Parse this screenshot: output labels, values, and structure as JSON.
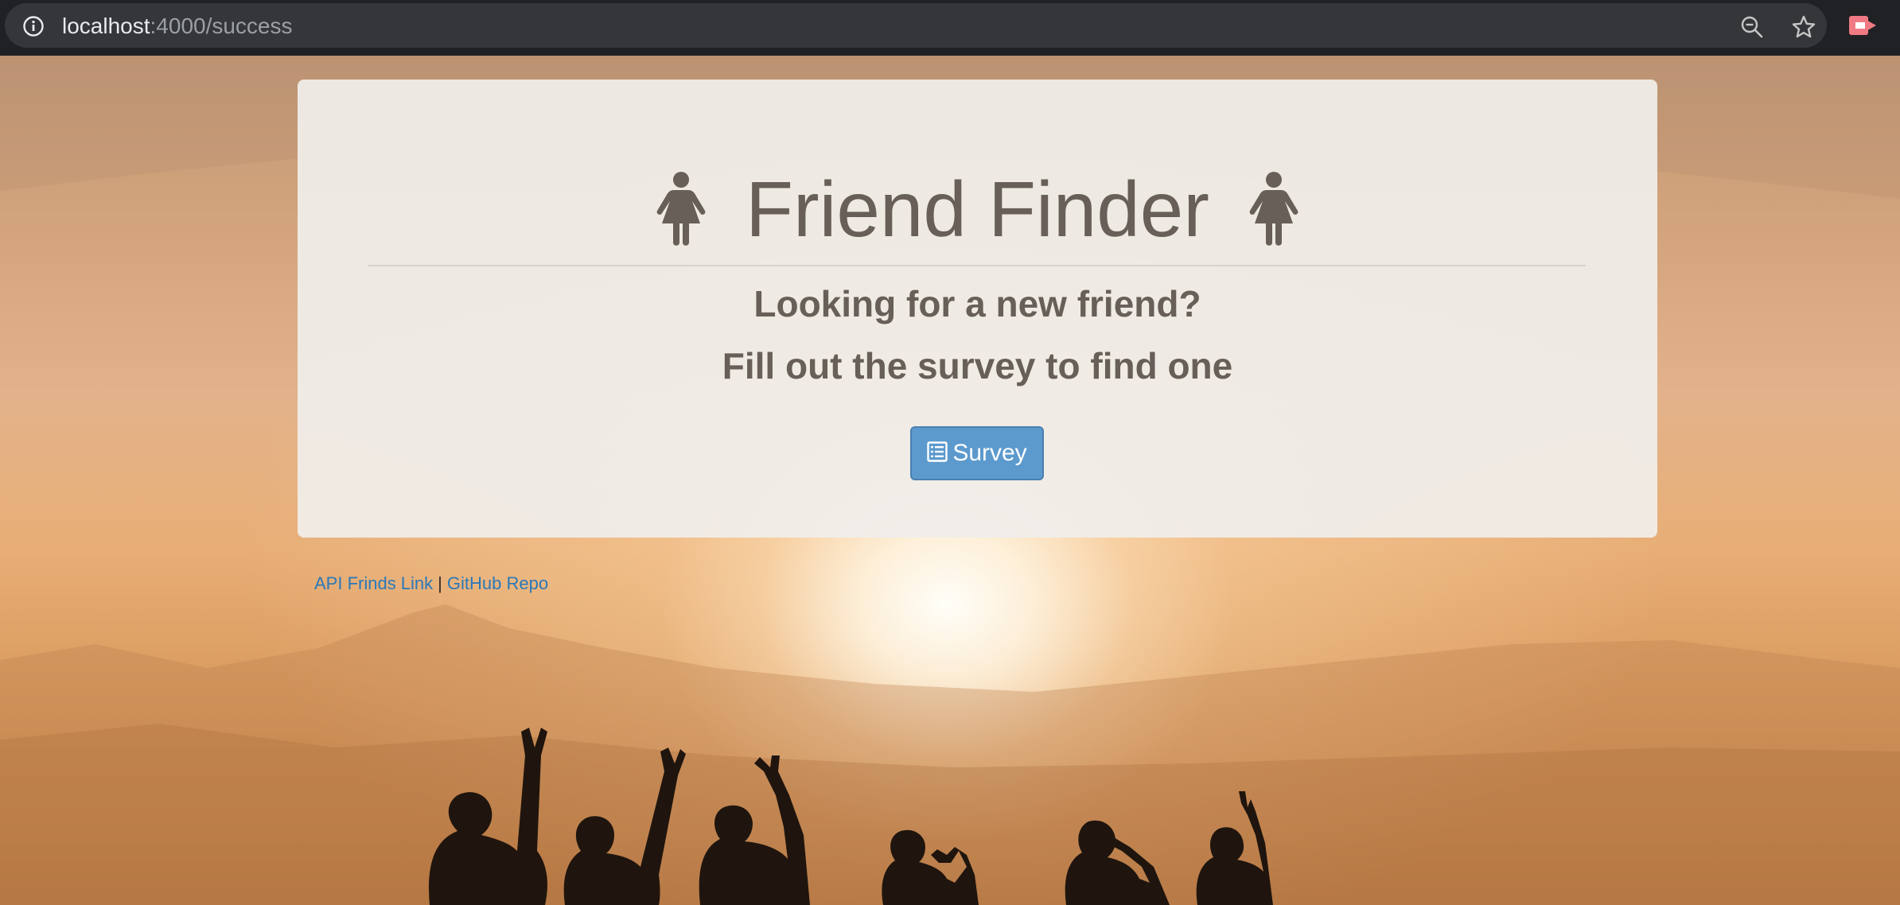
{
  "browser": {
    "url_host": "localhost",
    "url_rest": ":4000/success"
  },
  "page": {
    "title": "Friend Finder",
    "subtitle_1": "Looking for a new friend?",
    "subtitle_2": "Fill out the survey to find one",
    "survey_button": "Survey",
    "footer": {
      "api_link": "API Frinds Link",
      "separator": "|",
      "github_link": "GitHub Repo"
    }
  },
  "colors": {
    "heading": "#675f58",
    "button": "#5c9acd",
    "link": "#2a78b8"
  }
}
